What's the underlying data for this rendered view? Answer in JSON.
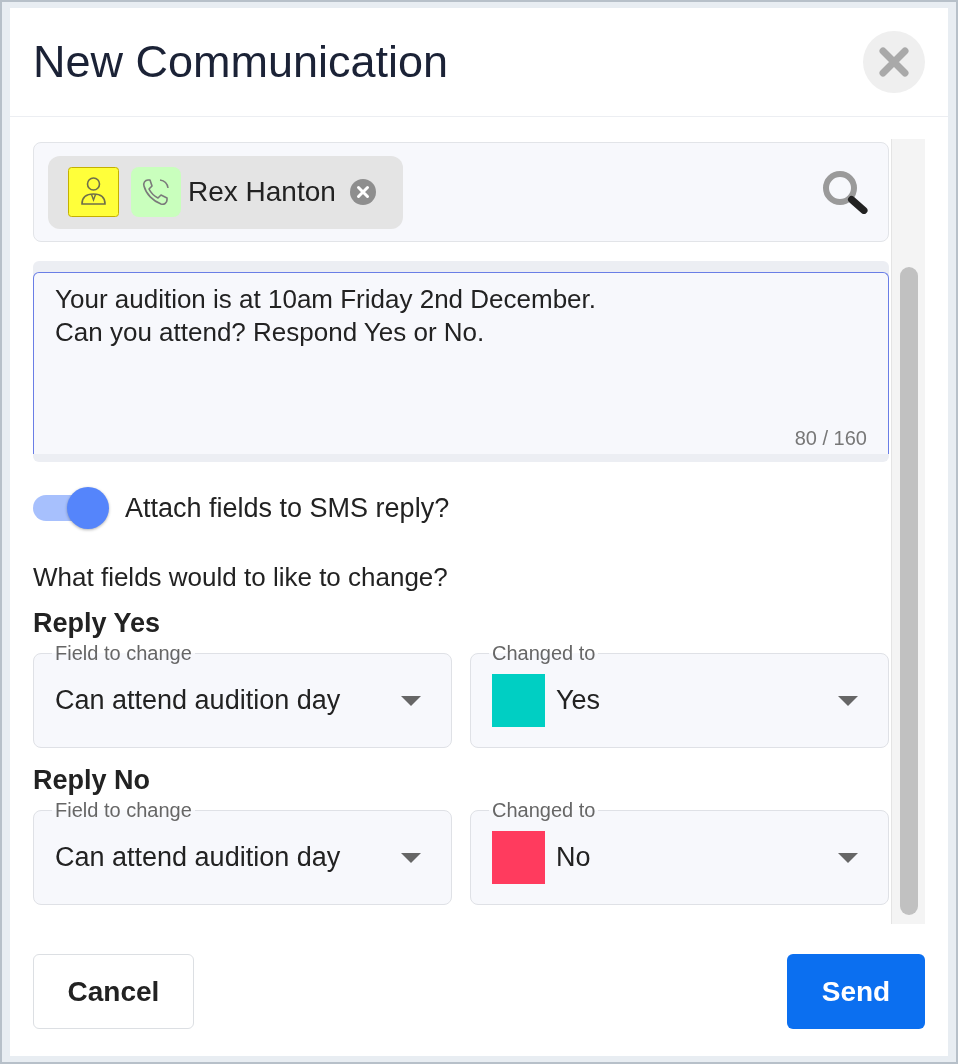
{
  "dialog": {
    "title": "New Communication"
  },
  "recipients": [
    {
      "name": "Rex Hanton"
    }
  ],
  "message": {
    "value": "Your audition is at 10am Friday 2nd December.\nCan you attend? Respond Yes or No.",
    "counter": "80 / 160"
  },
  "attach_toggle": {
    "label": "Attach fields to SMS reply?",
    "on": true
  },
  "question": "What fields would to like to change?",
  "replies": [
    {
      "heading": "Reply Yes",
      "selects": [
        {
          "legend": "Field to change",
          "value": "Can attend audition day"
        },
        {
          "legend": "Changed to",
          "value": "Yes",
          "color": "#00cfc3"
        }
      ]
    },
    {
      "heading": "Reply No",
      "selects": [
        {
          "legend": "Field to change",
          "value": "Can attend audition day"
        },
        {
          "legend": "Changed to",
          "value": "No",
          "color": "#ff3b5e"
        }
      ]
    }
  ],
  "buttons": [
    {
      "label": "Cancel",
      "kind": "secondary"
    },
    {
      "label": "Send",
      "kind": "primary"
    }
  ]
}
